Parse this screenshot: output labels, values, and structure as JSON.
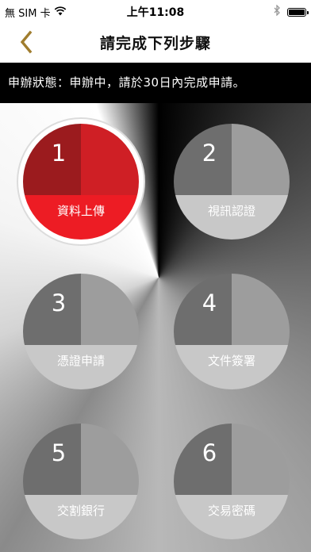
{
  "status_bar": {
    "carrier": "無 SIM 卡",
    "time": "上午11:08"
  },
  "nav": {
    "title": "請完成下列步驟",
    "back_icon": "chevron-left-icon",
    "accent_color": "#a07d2e"
  },
  "notice": {
    "text": "申辦狀態：申辦中，請於30日內完成申請。"
  },
  "steps": [
    {
      "number": "1",
      "label": "資料上傳",
      "state": "active"
    },
    {
      "number": "2",
      "label": "視訊認證",
      "state": "inactive"
    },
    {
      "number": "3",
      "label": "憑證申請",
      "state": "inactive"
    },
    {
      "number": "4",
      "label": "文件簽署",
      "state": "inactive"
    },
    {
      "number": "5",
      "label": "交割銀行",
      "state": "inactive"
    },
    {
      "number": "6",
      "label": "交易密碼",
      "state": "inactive"
    }
  ],
  "colors": {
    "active_top_left": "#9b1b1e",
    "active_top_right": "#cf1f25",
    "active_bottom": "#ed1c24",
    "inactive_top_left": "#6e6e6e",
    "inactive_top_right": "#9d9d9d",
    "inactive_bottom": "#c8c8c8"
  }
}
